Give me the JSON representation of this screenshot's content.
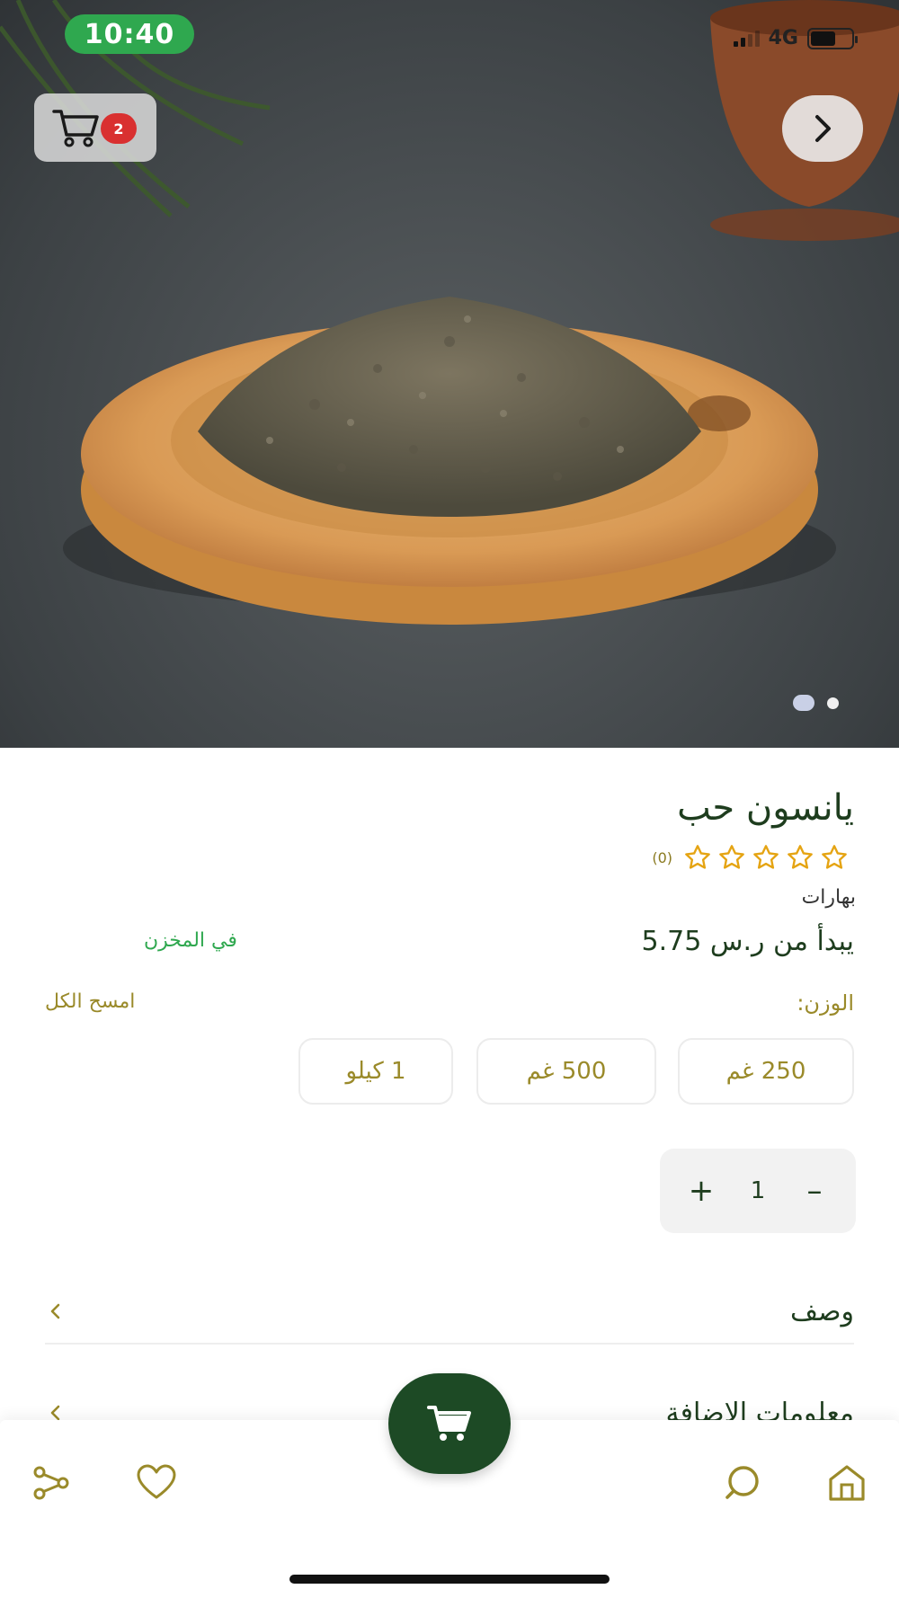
{
  "status_bar": {
    "time": "10:40",
    "network": "4G"
  },
  "hero": {
    "cart_count": "2"
  },
  "product": {
    "title": "يانسون حب",
    "rating_count": "(0)",
    "category": "بهارات",
    "price": "يبدأ من ر.س 5.75",
    "stock_status": "في المخزن",
    "weight_label": "الوزن:",
    "clear_all": "امسح الكل",
    "weight_options": [
      "250 غم",
      "500 غم",
      "1 كيلو"
    ],
    "quantity": "1"
  },
  "accordion": {
    "description": "وصف",
    "additional_info": "معلومات الاضافة"
  },
  "icons": {
    "cart": "cart-icon",
    "next": "chevron-right-icon",
    "star": "star-outline-icon",
    "share": "share-icon",
    "heart": "heart-icon",
    "search": "search-icon",
    "home": "home-icon"
  },
  "colors": {
    "brand_green": "#1d4a25",
    "accent_olive": "#9a8a2a",
    "stock_green": "#2fa84f",
    "badge_red": "#d93030",
    "star": "#e5a413"
  }
}
